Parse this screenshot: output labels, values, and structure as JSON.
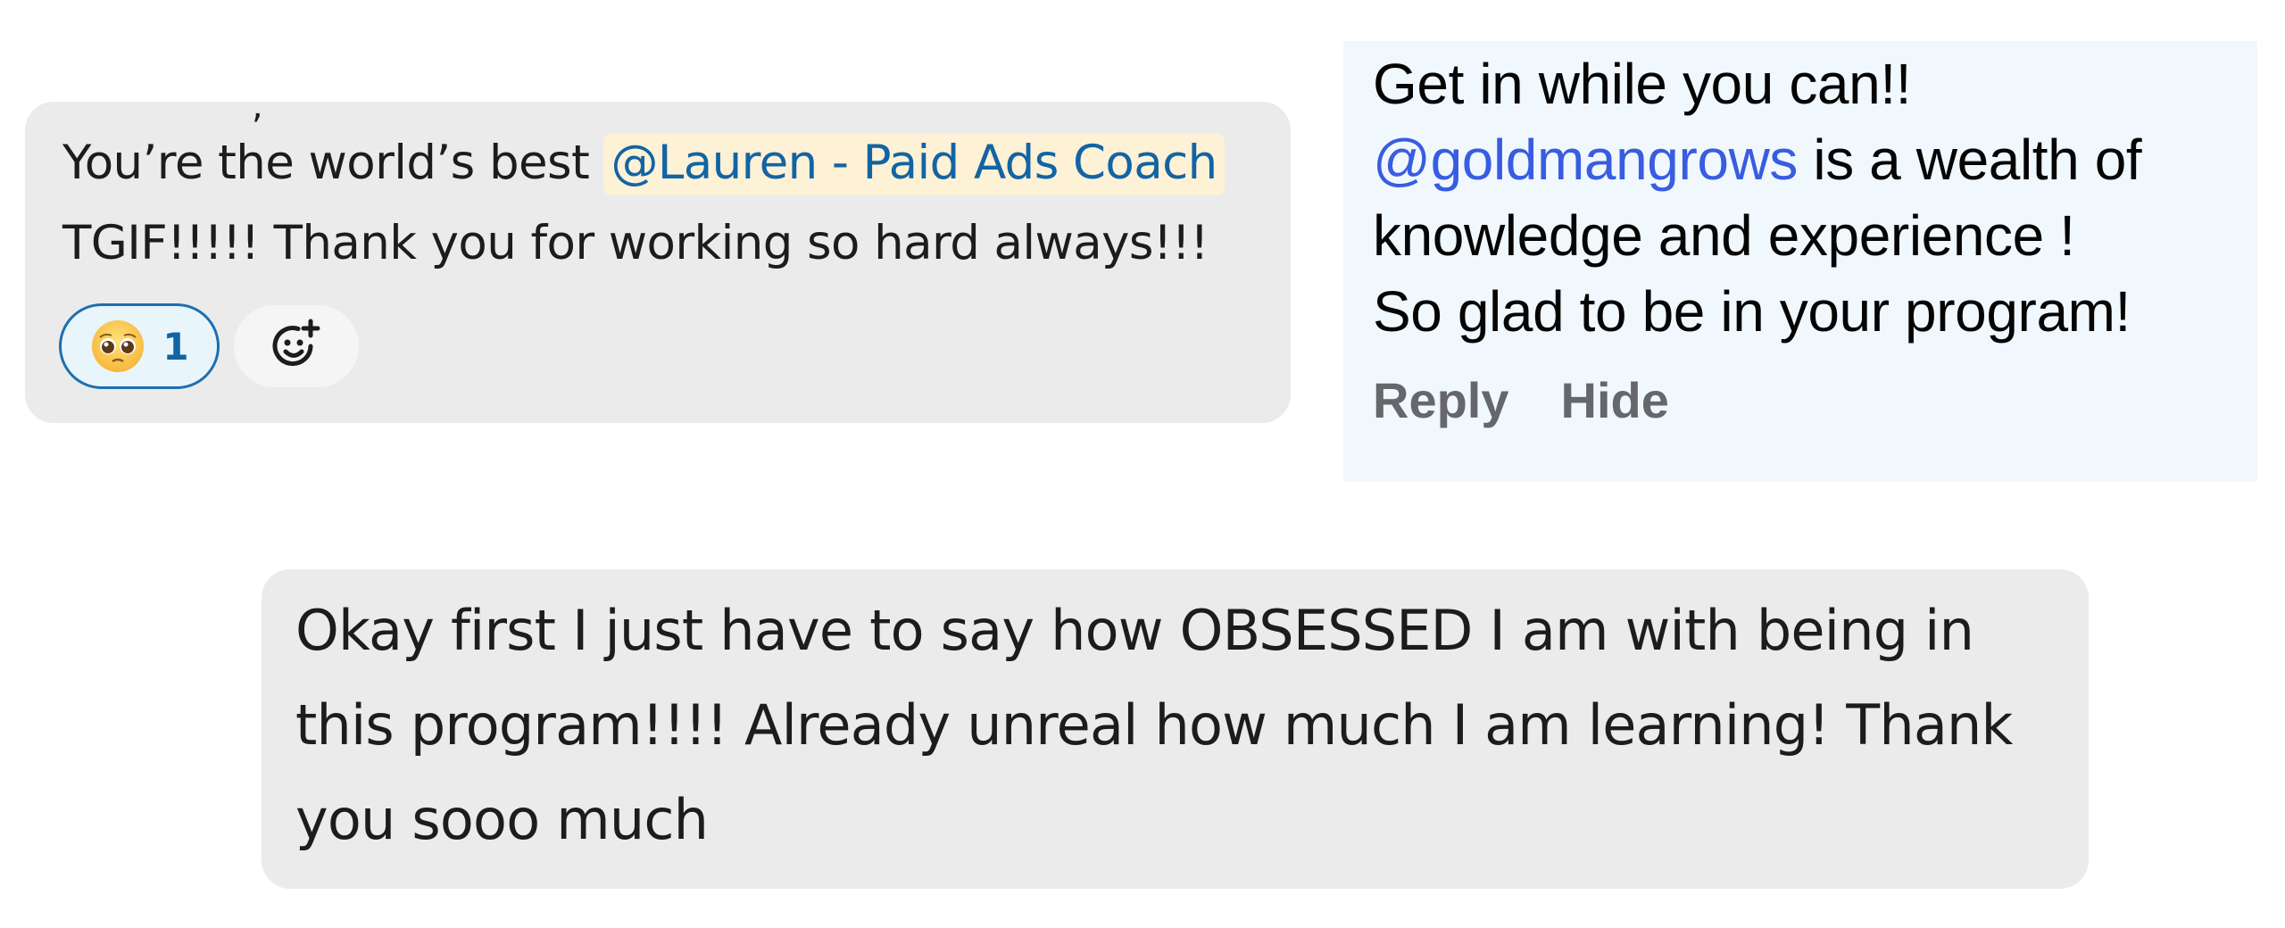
{
  "slack_message": {
    "line1_text": "You’re the world’s best ",
    "mention": "@Lauren - Paid Ads Coach",
    "line2_text": "TGIF!!!!! Thank you for working so hard always!!!",
    "reaction": {
      "emoji": "pleading-face-emoji",
      "count": "1"
    },
    "add_reaction_icon": "add-reaction-icon",
    "colors": {
      "background": "#ebebeb",
      "mention_bg": "#fdf1d6",
      "mention_text": "#1264a3",
      "reaction_border": "#1d6fb0"
    }
  },
  "comment": {
    "line1": "Get in while you can!!",
    "mention": "@goldmangrows",
    "line2_rest": " is a wealth of",
    "line3": "knowledge and experience !",
    "line4": "So glad to be in your program!",
    "actions": {
      "reply": "Reply",
      "hide": "Hide"
    },
    "colors": {
      "background": "#f1f8fd",
      "mention": "#385de0",
      "action_text": "#65676b"
    }
  },
  "bubble": {
    "line1": "Okay first I just have to say how OBSESSED I am with being in",
    "line2": "this program!!!! Already unreal how much I am learning! Thank",
    "line3": "you sooo much",
    "colors": {
      "background": "#ebebeb"
    }
  }
}
